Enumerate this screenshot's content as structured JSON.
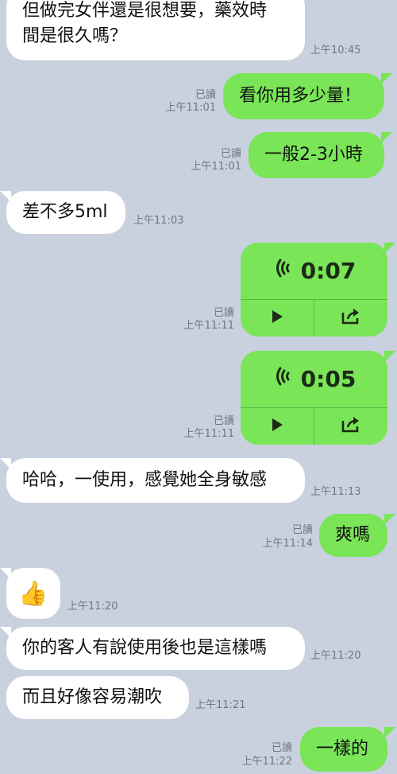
{
  "messages": [
    {
      "id": "m1",
      "side": "in",
      "text_line1": "但做完女伴還是很想要，藥效時",
      "text_line2": "間是很久嗎？",
      "time": "上午10:45"
    },
    {
      "id": "m2",
      "side": "out",
      "text": "看你用多少量！",
      "read": "已讀",
      "time": "上午11:01"
    },
    {
      "id": "m3",
      "side": "out",
      "text": "一般2-3小時",
      "read": "已讀",
      "time": "上午11:01"
    },
    {
      "id": "m4",
      "side": "in",
      "text": "差不多5ml",
      "time": "上午11:03"
    },
    {
      "id": "m5",
      "side": "out",
      "type": "voice",
      "duration": "0:07",
      "read": "已讀",
      "time": "上午11:11"
    },
    {
      "id": "m6",
      "side": "out",
      "type": "voice",
      "duration": "0:05",
      "read": "已讀",
      "time": "上午11:11"
    },
    {
      "id": "m7",
      "side": "in",
      "text": "哈哈，一使用，感覺她全身敏感",
      "time": "上午11:13"
    },
    {
      "id": "m8",
      "side": "out",
      "text": "爽嗎",
      "read": "已讀",
      "time": "上午11:14"
    },
    {
      "id": "m9",
      "side": "in",
      "type": "sticker",
      "emoji": "👍",
      "time": "上午11:20"
    },
    {
      "id": "m10",
      "side": "in",
      "text": "你的客人有說使用後也是這樣嗎",
      "time": "上午11:20"
    },
    {
      "id": "m11",
      "side": "in",
      "text": "而且好像容易潮吹",
      "time": "上午11:21"
    },
    {
      "id": "m12",
      "side": "out",
      "text": "一樣的",
      "read": "已讀",
      "time": "上午11:22"
    }
  ],
  "icons": {
    "voice_wave": "sound-wave-icon",
    "play": "play-icon",
    "share": "share-icon"
  },
  "colors": {
    "background": "#c9d1de",
    "incoming": "#ffffff",
    "outgoing": "#79e557",
    "meta_text": "#6f7785"
  }
}
